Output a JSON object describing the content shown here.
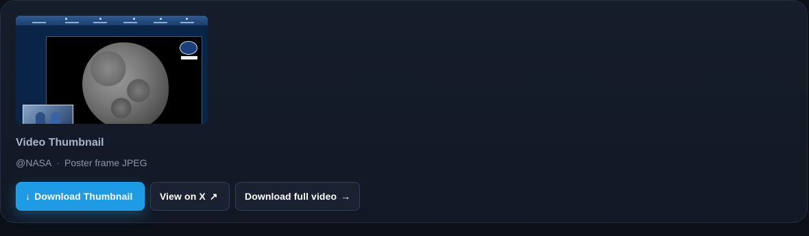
{
  "card": {
    "title": "Video Thumbnail",
    "author": "@NASA",
    "separator": "·",
    "meta": "Poster frame JPEG"
  },
  "actions": {
    "download_thumbnail": {
      "icon": "↓",
      "label": "Download Thumbnail"
    },
    "view_on_x": {
      "label": "View on X",
      "icon": "↗"
    },
    "download_full_video": {
      "label": "Download full video",
      "icon": "→"
    }
  },
  "colors": {
    "primary_button": "#1f9be6",
    "secondary_button": "#1a2231",
    "card_background": "#161d2a"
  },
  "icons": {
    "download": "download-arrow-icon",
    "external_link": "external-link-icon",
    "next": "arrow-right-icon"
  }
}
